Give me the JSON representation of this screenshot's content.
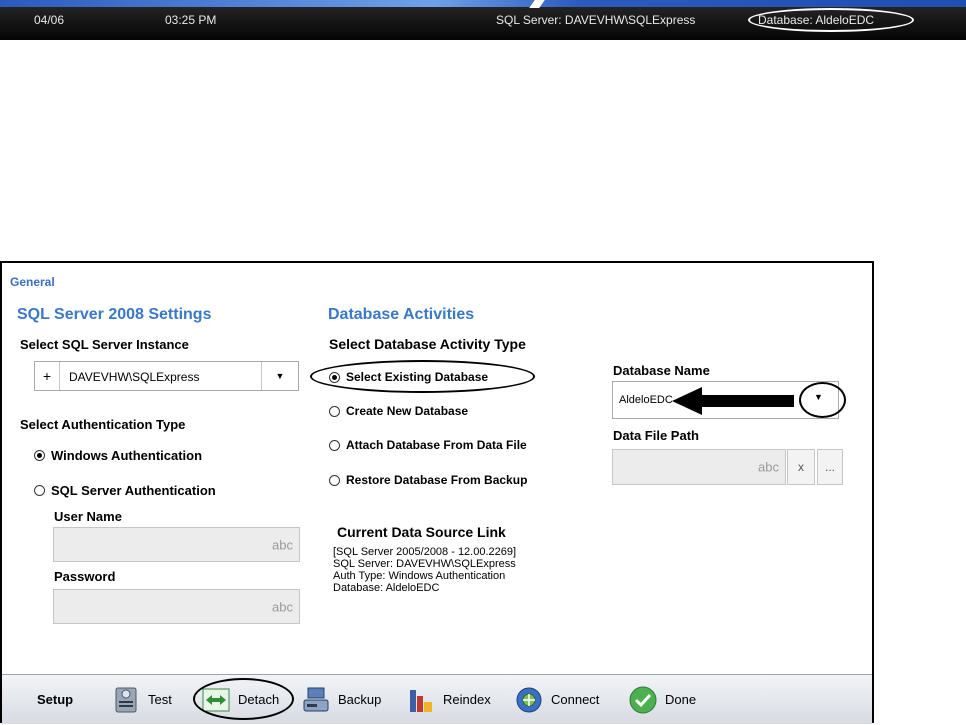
{
  "statusbar": {
    "date": "04/06",
    "time": "03:25 PM",
    "sql_server": "SQL Server: DAVEVHW\\SQLExpress",
    "database": "Database: AldeloEDC"
  },
  "dialog": {
    "tab_label": "General",
    "sql_settings": {
      "title": "SQL Server 2008 Settings",
      "instance_label": "Select SQL Server Instance",
      "instance_plus": "+",
      "instance_value": "DAVEVHW\\SQLExpress",
      "auth_label": "Select Authentication Type",
      "auth_windows": "Windows Authentication",
      "auth_sql": "SQL Server Authentication",
      "auth_selected": "windows",
      "user_label": "User Name",
      "user_hint": "abc",
      "password_label": "Password",
      "password_hint": "abc"
    },
    "db_activities": {
      "title": "Database Activities",
      "activity_label": "Select Database Activity Type",
      "options": [
        "Select Existing Database",
        "Create New Database",
        "Attach Database From Data File",
        "Restore Database From Backup"
      ],
      "selected_index": 0,
      "current_link_title": "Current Data Source Link",
      "current_link_lines": [
        "[SQL Server 2005/2008 - 12.00.2269]",
        "SQL Server: DAVEVHW\\SQLExpress",
        "Auth Type: Windows Authentication",
        "Database: AldeloEDC"
      ]
    },
    "db_name": {
      "label": "Database Name",
      "value": "AldeloEDC",
      "file_path_label": "Data File Path",
      "file_path_hint": "abc",
      "clear_label": "x",
      "browse_label": "..."
    }
  },
  "toolbar": {
    "setup": "Setup",
    "test": "Test",
    "detach": "Detach",
    "backup": "Backup",
    "reindex": "Reindex",
    "connect": "Connect",
    "done": "Done"
  },
  "colors": {
    "section_title": "#3a78c8",
    "statusbar_bg": "#0a0a0a",
    "accent_blue": "#2a5bbd"
  }
}
